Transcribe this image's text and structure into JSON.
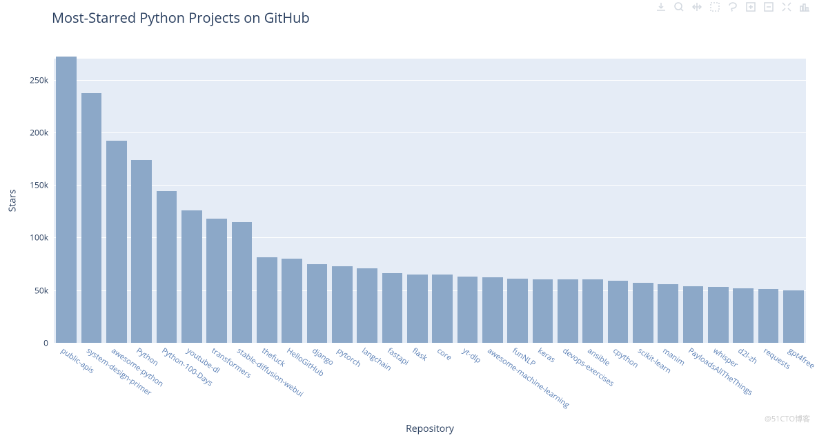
{
  "chart_data": {
    "type": "bar",
    "title": "Most-Starred Python Projects on GitHub",
    "xlabel": "Repository",
    "ylabel": "Stars",
    "ylim": [
      0,
      270000
    ],
    "y_ticks": [
      0,
      50000,
      100000,
      150000,
      200000,
      250000
    ],
    "y_tick_labels": [
      "0",
      "50k",
      "100k",
      "150k",
      "200k",
      "250k"
    ],
    "categories": [
      "public-apis",
      "system-design-primer",
      "awesome-python",
      "Python",
      "Python-100-Days",
      "youtube-dl",
      "transformers",
      "stable-diffusion-webui",
      "thefuck",
      "HelloGitHub",
      "django",
      "pytorch",
      "langchain",
      "fastapi",
      "flask",
      "core",
      "yt-dlp",
      "awesome-machine-learning",
      "funNLP",
      "keras",
      "devops-exercises",
      "ansible",
      "cpython",
      "scikit-learn",
      "manim",
      "PayloadsAllTheThings",
      "whisper",
      "d2l-zh",
      "requests",
      "gpt4free"
    ],
    "values": [
      272000,
      237000,
      192000,
      174000,
      144000,
      126000,
      118000,
      115000,
      81000,
      80000,
      75000,
      73000,
      71000,
      66000,
      65000,
      65000,
      63000,
      62000,
      61000,
      60000,
      60000,
      60000,
      59000,
      57000,
      56000,
      54000,
      53000,
      52000,
      51000,
      50000
    ]
  },
  "toolbar": {
    "download": "Download plot as a png",
    "zoom": "Zoom",
    "pan": "Pan",
    "select": "Box Select",
    "lasso": "Lasso Select",
    "zoom_in": "Zoom in",
    "zoom_out": "Zoom out",
    "autoscale": "Autoscale",
    "reset": "Reset axes"
  },
  "watermark": "@51CTO博客"
}
